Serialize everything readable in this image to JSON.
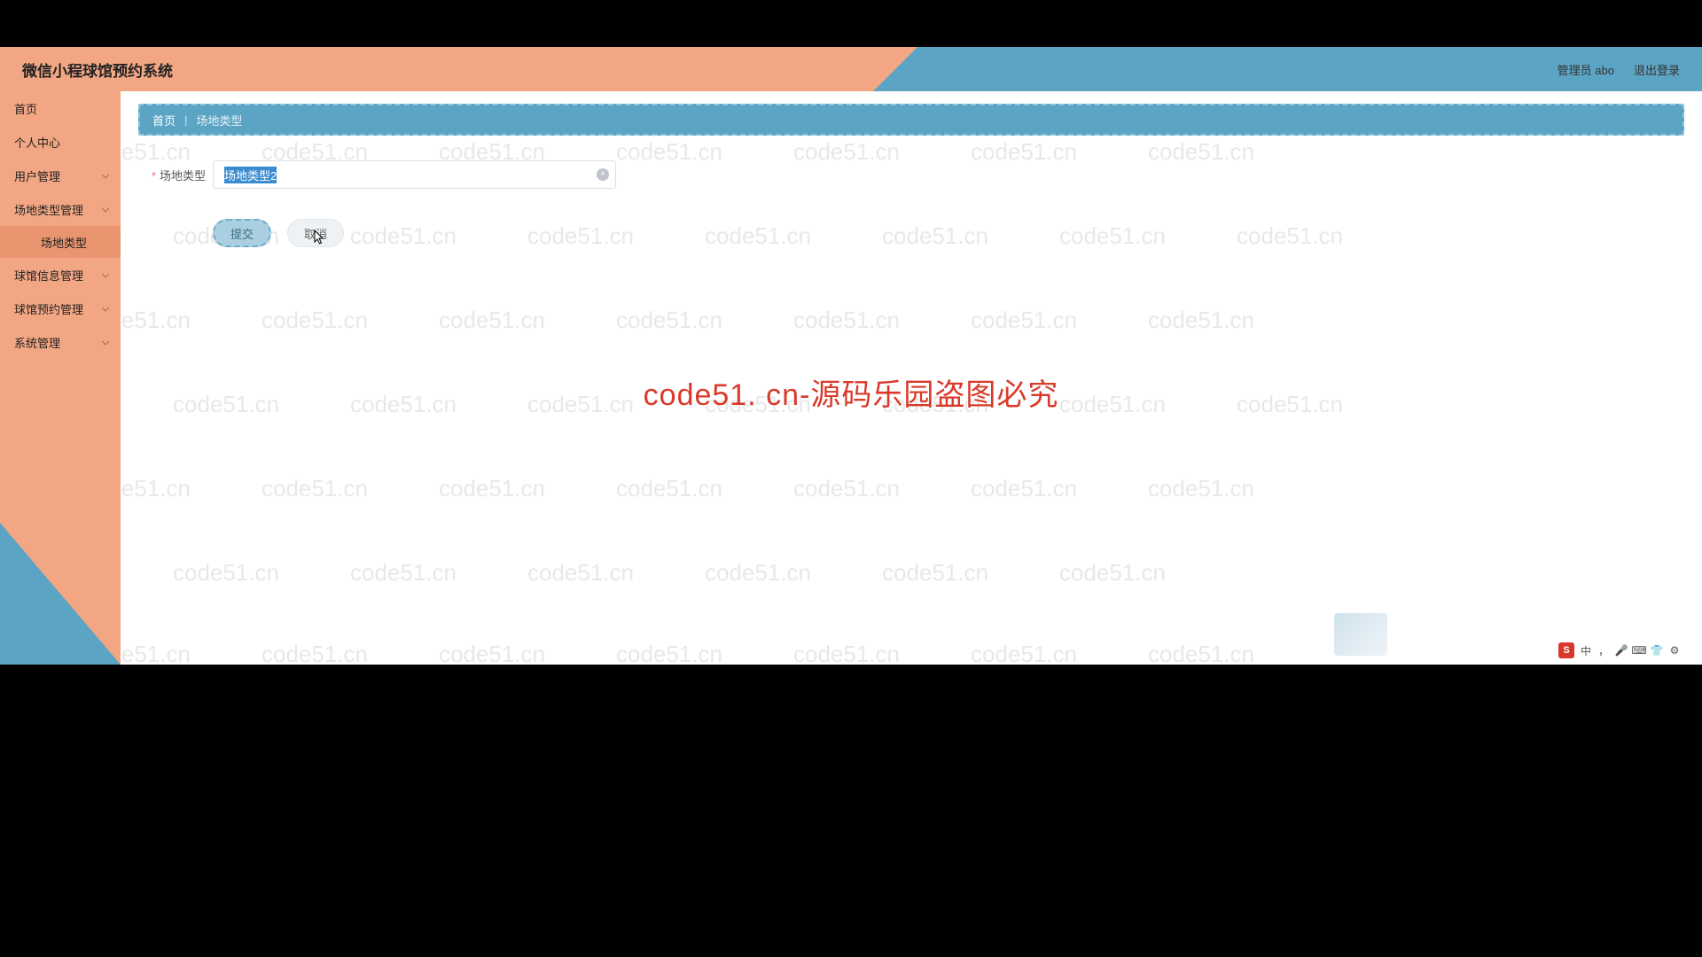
{
  "header": {
    "title": "微信小程球馆预约系统",
    "admin_label": "管理员 abo",
    "logout_label": "退出登录"
  },
  "sidebar": {
    "items": [
      {
        "label": "首页",
        "expandable": false
      },
      {
        "label": "个人中心",
        "expandable": false
      },
      {
        "label": "用户管理",
        "expandable": true
      },
      {
        "label": "场地类型管理",
        "expandable": true,
        "sub": [
          {
            "label": "场地类型"
          }
        ]
      },
      {
        "label": "球馆信息管理",
        "expandable": true
      },
      {
        "label": "球馆预约管理",
        "expandable": true
      },
      {
        "label": "系统管理",
        "expandable": true
      }
    ]
  },
  "breadcrumb": {
    "home": "首页",
    "current": "场地类型"
  },
  "form": {
    "field_label": "场地类型",
    "field_value": "场地类型2",
    "submit_label": "提交",
    "cancel_label": "取消"
  },
  "watermark": {
    "text": "code51.cn",
    "center_text": "code51. cn-源码乐园盗图必究"
  },
  "ime": {
    "brand": "S"
  }
}
